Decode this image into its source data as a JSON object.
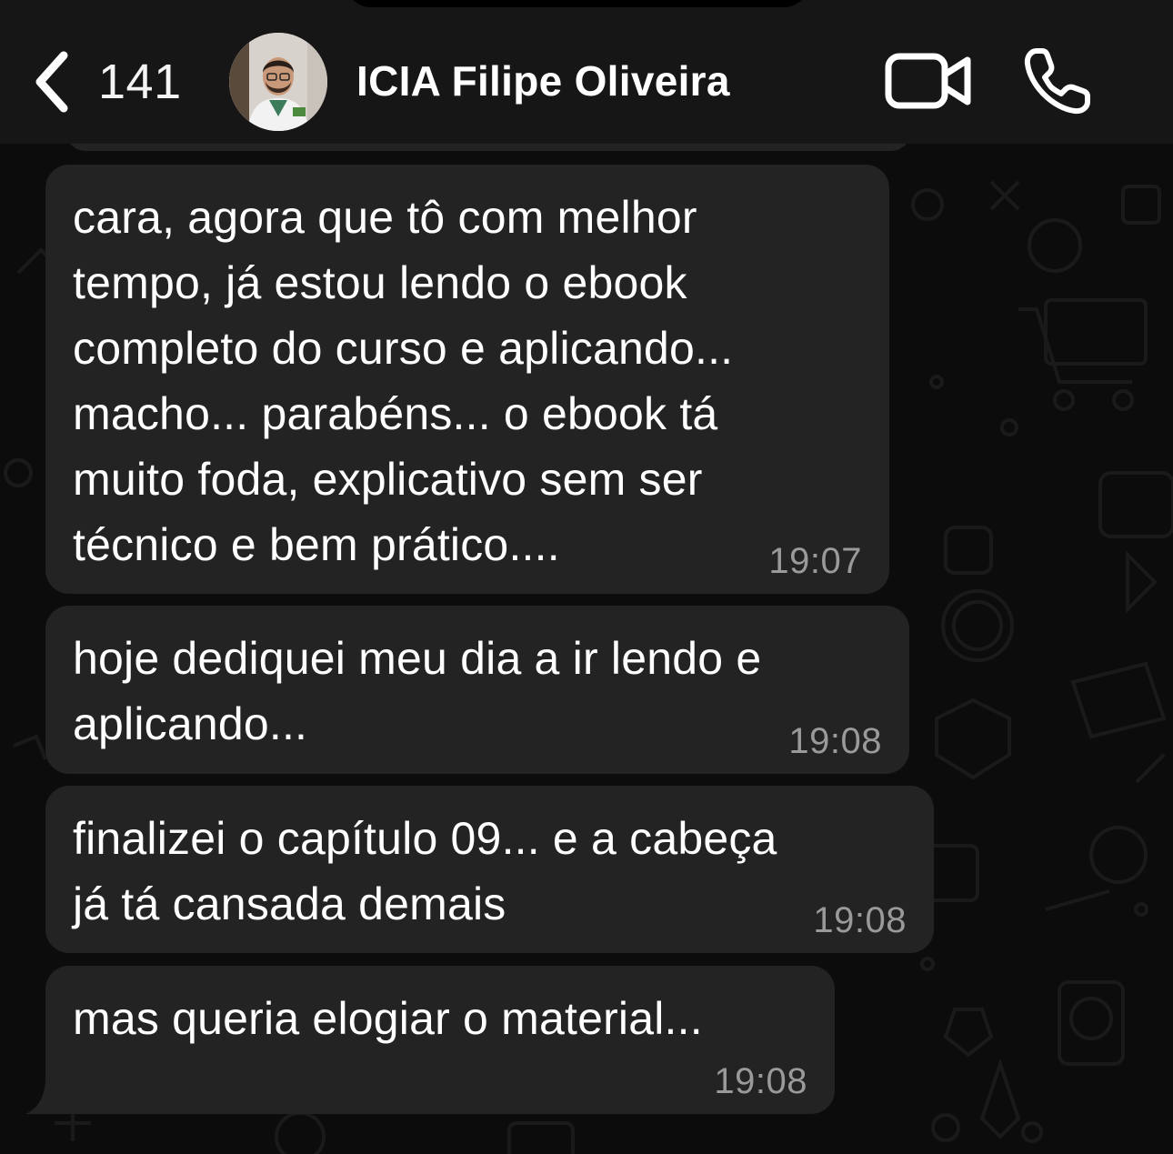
{
  "header": {
    "back_count": "141",
    "contact_name": "ICIA Filipe Oliveira"
  },
  "icons": {
    "back": "chevron-left-icon",
    "video": "video-camera-icon",
    "call": "phone-icon"
  },
  "colors": {
    "background": "#0c0c0c",
    "header_bg": "#161616",
    "bubble_bg": "#232323",
    "text": "#ffffff",
    "timestamp": "#9a9a9a"
  },
  "messages": [
    {
      "text": "cara, agora que tô com melhor\ntempo, já estou lendo o ebook\ncompleto do curso e aplicando...\nmacho... parabéns... o ebook tá\nmuito foda, explicativo sem ser\ntécnico e bem prático....",
      "time": "19:07"
    },
    {
      "text": "hoje dediquei meu dia a ir lendo e\naplicando...",
      "time": "19:08"
    },
    {
      "text": "finalizei o capítulo 09... e a cabeça\njá tá cansada demais",
      "time": "19:08"
    },
    {
      "text": "mas queria elogiar o material...",
      "time": "19:08"
    }
  ]
}
